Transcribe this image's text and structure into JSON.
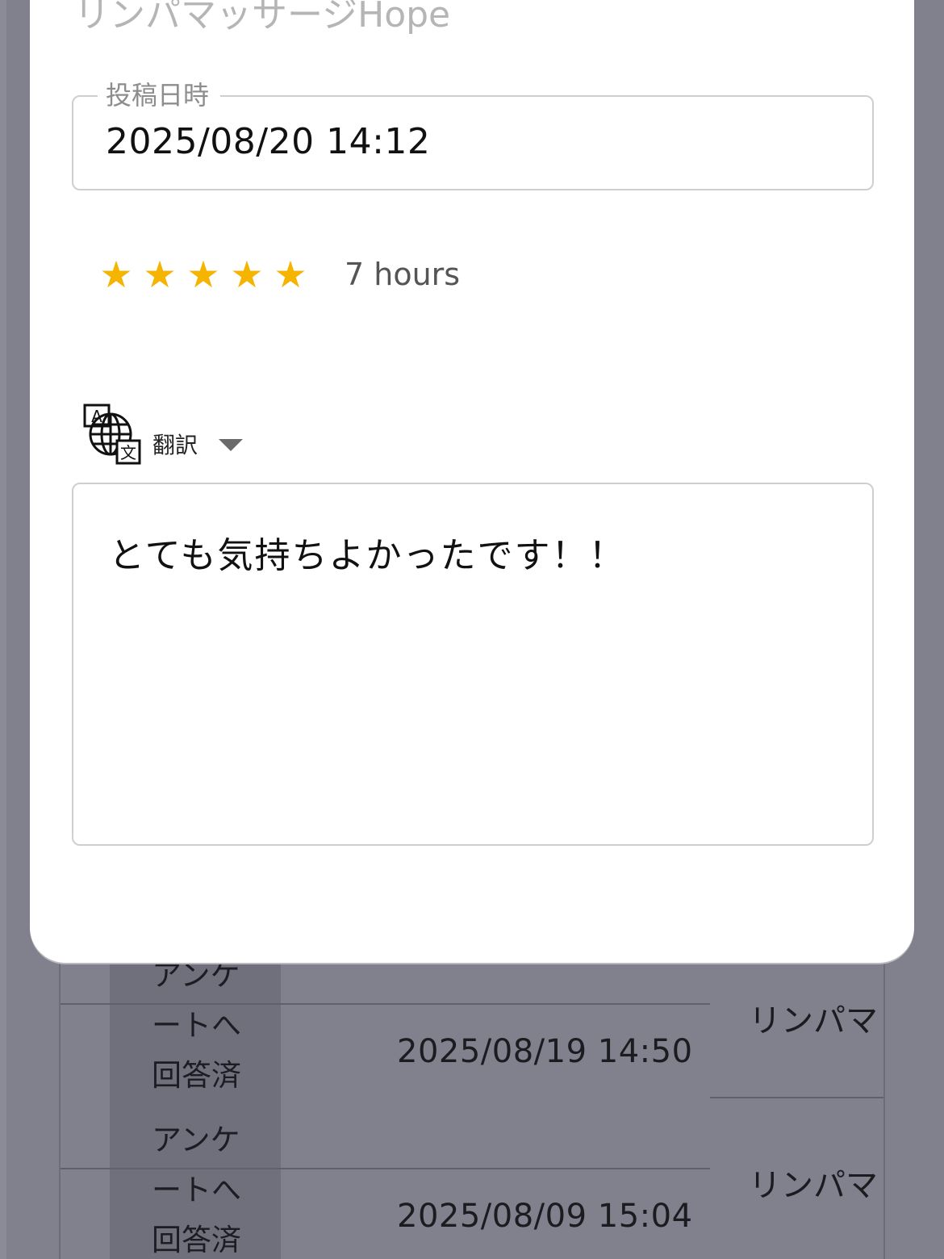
{
  "modal": {
    "shop_name": "リンパマッサージHope",
    "posted_label": "投稿日時",
    "posted_value": "2025/08/20 14:12",
    "rating": 5,
    "rating_max": 5,
    "star_glyph": "★",
    "time_ago": "7 hours",
    "translate_label": "翻訳",
    "review_text": "とても気持ちよかったです！！",
    "star_color": "#f5b400"
  },
  "background_list": {
    "rows": [
      {
        "status": [
          "アンケ",
          "ートへ",
          "回答済"
        ],
        "date": "2025/08/19 14:50",
        "shop": "リンパマ"
      },
      {
        "status": [
          "アンケ",
          "ートへ",
          "回答済"
        ],
        "date": "2025/08/09 15:04",
        "shop": "リンパマ"
      }
    ]
  }
}
